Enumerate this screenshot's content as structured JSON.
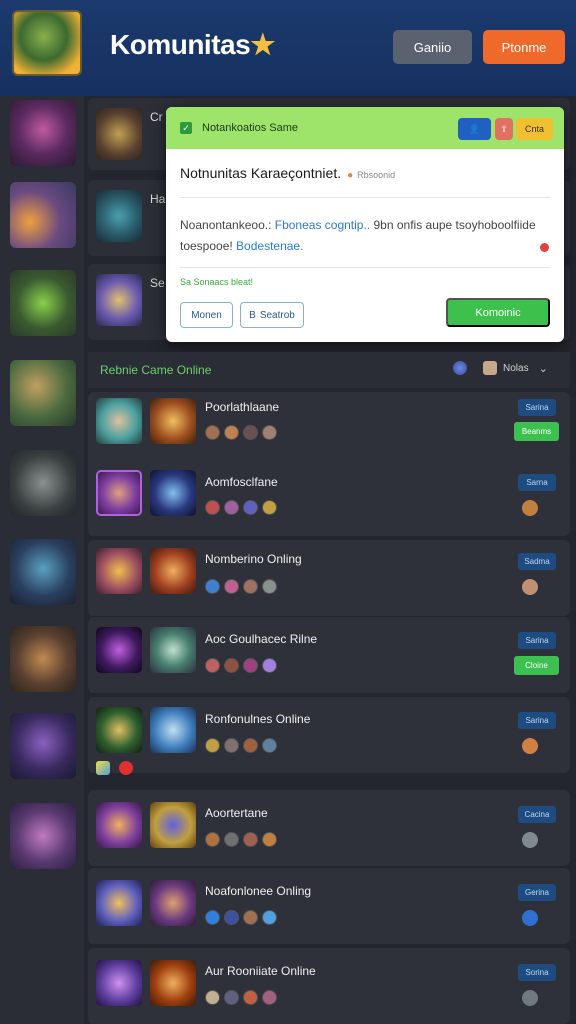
{
  "header": {
    "brand": "Komunitas",
    "brand_star": "★",
    "btn_gray": "Ganiio",
    "btn_orange": "Ptonme",
    "colors": {
      "bar": "#1c3a6e",
      "orange": "#ef6a2a",
      "gray": "#5a6270"
    }
  },
  "top_cards": [
    {
      "label": "Cr"
    },
    {
      "label": "Ha"
    },
    {
      "label": "Se"
    }
  ],
  "modal": {
    "header_title": "Notankoatios Same",
    "tag_3": "Cnta",
    "title": "Notnunitas Karaeçontniet.",
    "title_sub": "Rbsoonid",
    "desc_1": "Noanontankeoo.: ",
    "desc_link_1": "Fboneas cogntip..",
    "desc_2": " 9bn onfis aupe tsoyhoboolfiide",
    "desc_3": "toespooe! ",
    "desc_link_2": "Bodestenae.",
    "green_note": "Sa Sonaacs bleat!",
    "btn_1": "Monen",
    "btn_2": "Seatrob",
    "btn_2_prefix": "B",
    "btn_primary": "Komoinic"
  },
  "section": {
    "title": "Rebnie Came Online",
    "filter_label": "Nolas"
  },
  "rows": [
    {
      "title": "Poorlathlaane",
      "badge": "Sarina",
      "badge2": "Beanms"
    },
    {
      "title": "Aomfosclfane",
      "badge": "Sarna",
      "badge2": ""
    },
    {
      "title": "Nomberino Onling",
      "badge": "Sadma",
      "badge2": ""
    },
    {
      "title": "Aoc Goulhacec Rilne",
      "badge": "Sarina",
      "badge2": "Cloine"
    },
    {
      "title": "Ronfonulnes Online",
      "badge": "Sarina",
      "badge2": ""
    },
    {
      "title": "Aoortertane",
      "badge": "Cacina",
      "badge2": ""
    },
    {
      "title": "Noafonlonee Onling",
      "badge": "Gerina",
      "badge2": ""
    },
    {
      "title": "Aur Rooniiate Online",
      "badge": "Sorina",
      "badge2": ""
    }
  ]
}
